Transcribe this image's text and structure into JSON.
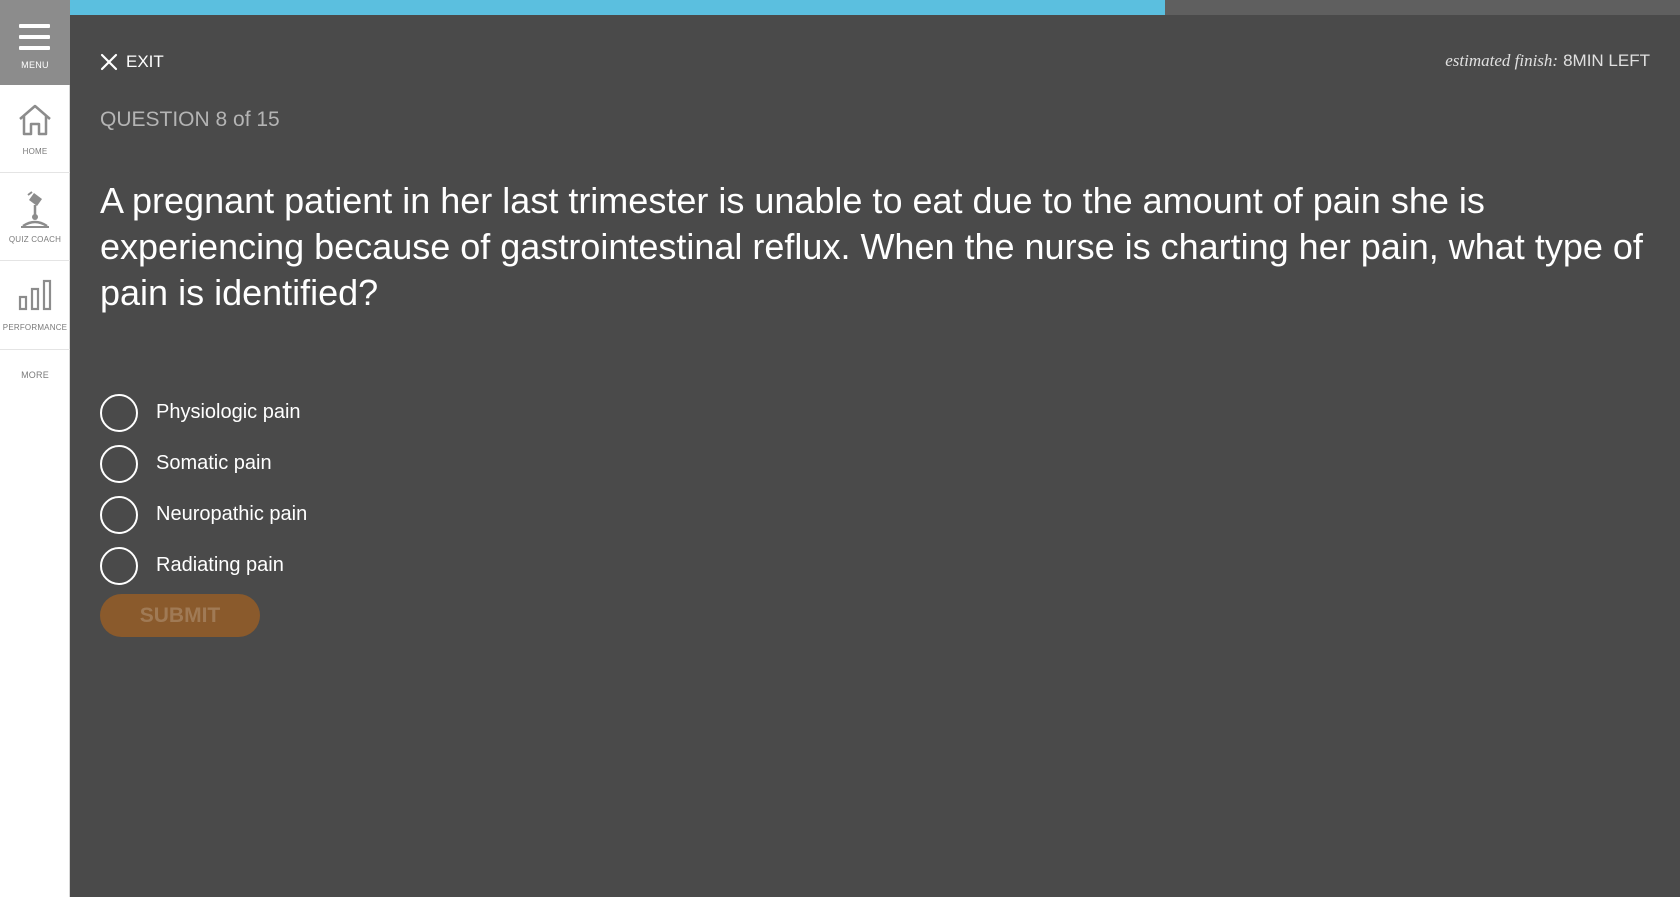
{
  "sidebar": {
    "menu_label": "MENU",
    "items": [
      {
        "label": "HOME",
        "icon": "home-icon"
      },
      {
        "label": "QUIZ COACH",
        "icon": "quiz-coach-icon"
      },
      {
        "label": "PERFORMANCE",
        "icon": "performance-icon"
      },
      {
        "label": "MORE"
      }
    ]
  },
  "progress": {
    "fraction": 0.68,
    "color": "#5bbfdf"
  },
  "header": {
    "exit_label": "EXIT",
    "estimated_prefix": "estimated finish:",
    "estimated_value": "8MIN LEFT"
  },
  "question": {
    "number_label": "QUESTION 8 of 15",
    "text": "A pregnant patient in her last trimester is unable to eat due to the amount of pain she is experiencing because of gastrointestinal reflux. When the nurse is charting her pain, what type of pain is identified?",
    "options": [
      {
        "label": "Physiologic pain"
      },
      {
        "label": "Somatic pain"
      },
      {
        "label": "Neuropathic pain"
      },
      {
        "label": "Radiating pain"
      }
    ]
  },
  "submit_label": "SUBMIT",
  "colors": {
    "background": "#4a4a4a",
    "accent": "#5bbfdf",
    "submit": "#8a5a2c"
  }
}
